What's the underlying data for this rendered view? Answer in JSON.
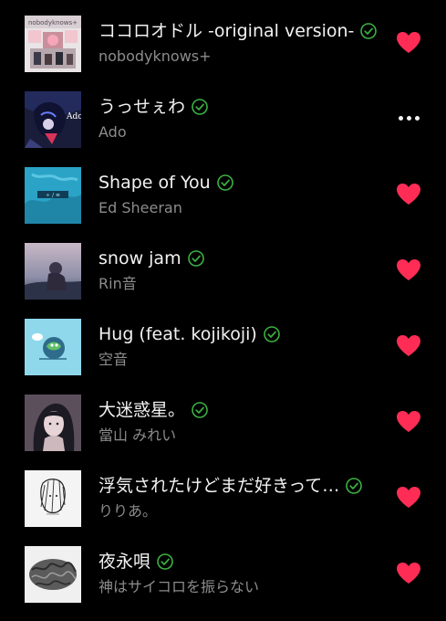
{
  "colors": {
    "background": "#000000",
    "title": "#f2f2f2",
    "artist": "#8c8c8c",
    "verified": "#3cb043",
    "heart": "#ff2d55"
  },
  "tracks": [
    {
      "title": "ココロオドル -original version-",
      "artist": "nobodyknows+",
      "verified": true,
      "action_icon": "heart-icon"
    },
    {
      "title": "うっせぇわ",
      "artist": "Ado",
      "verified": true,
      "action_icon": "more-options-icon"
    },
    {
      "title": "Shape of You",
      "artist": "Ed Sheeran",
      "verified": true,
      "action_icon": "heart-icon"
    },
    {
      "title": "snow jam",
      "artist": "Rin音",
      "verified": true,
      "action_icon": "heart-icon"
    },
    {
      "title": "Hug (feat. kojikoji)",
      "artist": "空音",
      "verified": true,
      "action_icon": "heart-icon"
    },
    {
      "title": "大迷惑星。",
      "artist": "當山 みれい",
      "verified": true,
      "action_icon": "heart-icon"
    },
    {
      "title": "浮気されたけどまだ好きって…",
      "artist": "りりあ。",
      "verified": true,
      "action_icon": "heart-icon"
    },
    {
      "title": "夜永唄",
      "artist": "神はサイコロを振らない",
      "verified": true,
      "action_icon": "heart-icon"
    }
  ],
  "album_art_text": {
    "ado": "Ado",
    "nobodyknows": "nobodyknows+"
  }
}
